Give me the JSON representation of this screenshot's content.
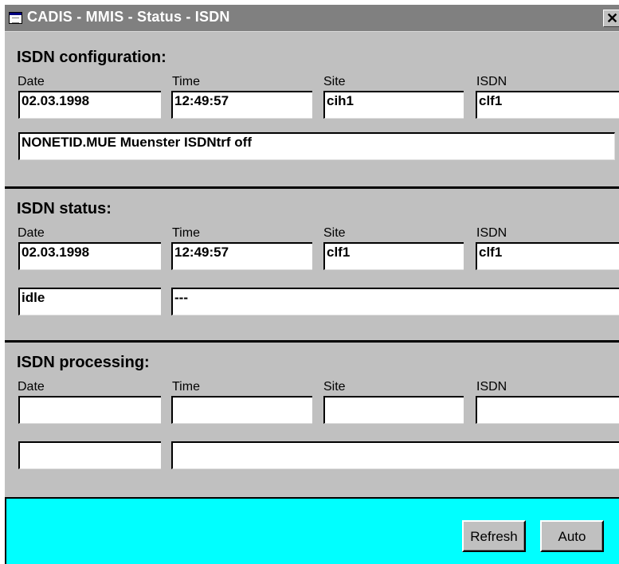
{
  "window": {
    "title": "CADIS - MMIS - Status - ISDN",
    "close_glyph": "✕"
  },
  "column_labels": {
    "date": "Date",
    "time": "Time",
    "site": "Site",
    "isdn": "ISDN"
  },
  "configuration": {
    "title": "ISDN configuration:",
    "date": "02.03.1998",
    "time": "12:49:57",
    "site": "cih1",
    "isdn": "clf1",
    "description": "NONETID.MUE Muenster ISDNtrf off"
  },
  "status": {
    "title": "ISDN status:",
    "date": "02.03.1998",
    "time": "12:49:57",
    "site": "clf1",
    "isdn": "clf1",
    "state": "idle",
    "detail": "---"
  },
  "processing": {
    "title": "ISDN processing:",
    "date": "",
    "time": "",
    "site": "",
    "isdn": "",
    "state": "",
    "detail": ""
  },
  "buttons": {
    "refresh": "Refresh",
    "auto": "Auto"
  },
  "colors": {
    "window_bg": "#c0c0c0",
    "footer_bg": "#00ffff",
    "titlebar_bg": "#808080"
  }
}
